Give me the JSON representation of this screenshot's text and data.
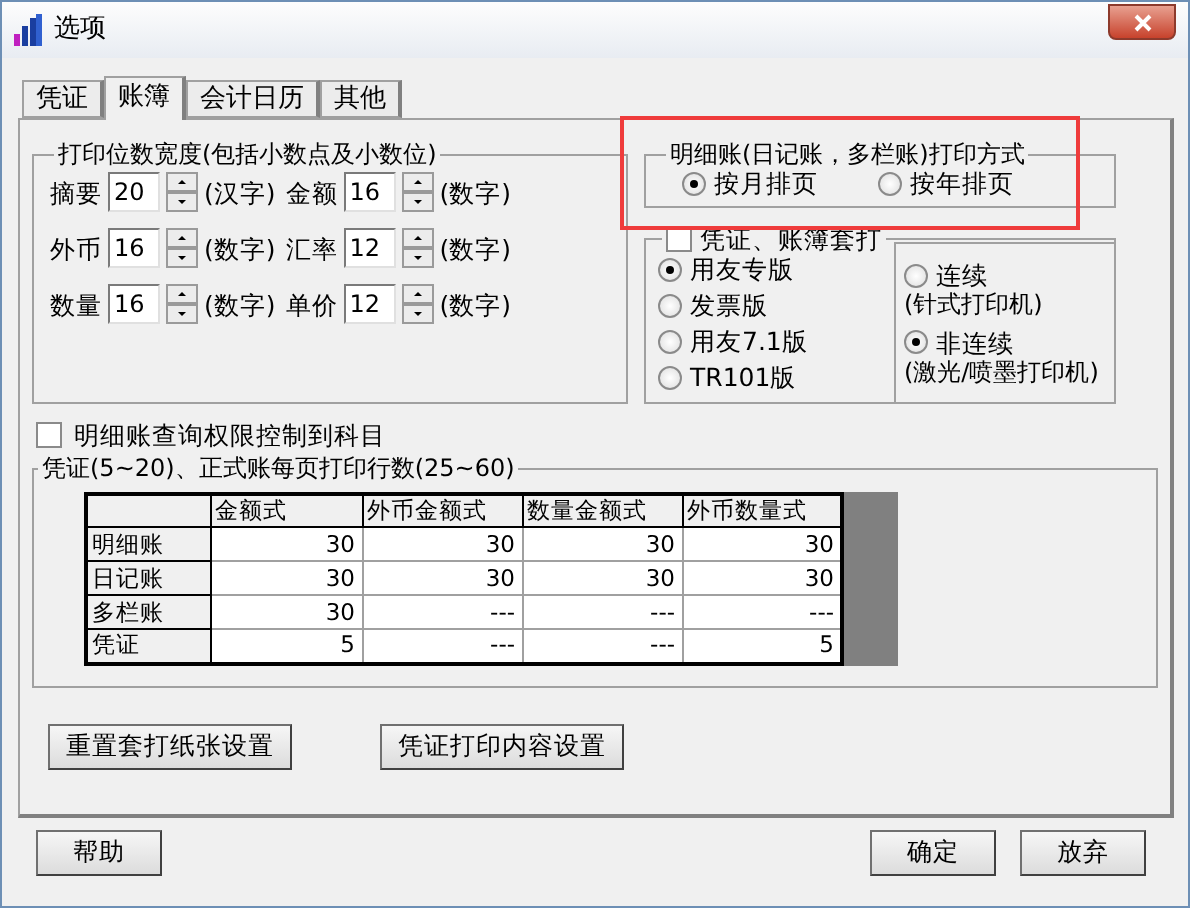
{
  "window": {
    "title": "选项"
  },
  "tabs": [
    {
      "label": "凭证",
      "selected": false
    },
    {
      "label": "账簿",
      "selected": true
    },
    {
      "label": "会计日历",
      "selected": false
    },
    {
      "label": "其他",
      "selected": false
    }
  ],
  "print_width": {
    "title": "打印位数宽度(包括小数点及小数位)",
    "rows": [
      [
        {
          "label": "摘要",
          "value": "20",
          "unit": "(汉字)"
        },
        {
          "label": "金额",
          "value": "16",
          "unit": "(数字)"
        }
      ],
      [
        {
          "label": "外币",
          "value": "16",
          "unit": "(数字)"
        },
        {
          "label": "汇率",
          "value": "12",
          "unit": "(数字)"
        }
      ],
      [
        {
          "label": "数量",
          "value": "16",
          "unit": "(数字)"
        },
        {
          "label": "单价",
          "value": "12",
          "unit": "(数字)"
        }
      ]
    ]
  },
  "ledger_print_mode": {
    "title": "明细账(日记账，多栏账)打印方式",
    "options": [
      {
        "label": "按月排页",
        "selected": true
      },
      {
        "label": "按年排页",
        "selected": false
      }
    ]
  },
  "set_print": {
    "label": "凭证、账簿套打",
    "checked": false,
    "versions": [
      {
        "label": "用友专版",
        "selected": true
      },
      {
        "label": "发票版",
        "selected": false
      },
      {
        "label": "用友7.1版",
        "selected": false
      },
      {
        "label": "TR101版",
        "selected": false
      }
    ],
    "feed": [
      {
        "label": "连续",
        "note": "(针式打印机)",
        "selected": false
      },
      {
        "label": "非连续",
        "note": "(激光/喷墨打印机)",
        "selected": true
      }
    ]
  },
  "restrict": {
    "label": "明细账查询权限控制到科目",
    "checked": false
  },
  "lines_per_page": {
    "title": "凭证(5~20)、正式账每页打印行数(25~60)",
    "columns": [
      "金额式",
      "外币金额式",
      "数量金额式",
      "外币数量式"
    ],
    "rows": [
      {
        "label": "明细账",
        "cells": [
          "30",
          "30",
          "30",
          "30"
        ]
      },
      {
        "label": "日记账",
        "cells": [
          "30",
          "30",
          "30",
          "30"
        ]
      },
      {
        "label": "多栏账",
        "cells": [
          "30",
          "---",
          "---",
          "---"
        ]
      },
      {
        "label": "凭证",
        "cells": [
          "5",
          "---",
          "---",
          "5"
        ]
      }
    ]
  },
  "buttons": [
    "重置套打纸张设置",
    "凭证打印内容设置"
  ],
  "footer_buttons": [
    "帮助",
    "确定",
    "放弃"
  ]
}
